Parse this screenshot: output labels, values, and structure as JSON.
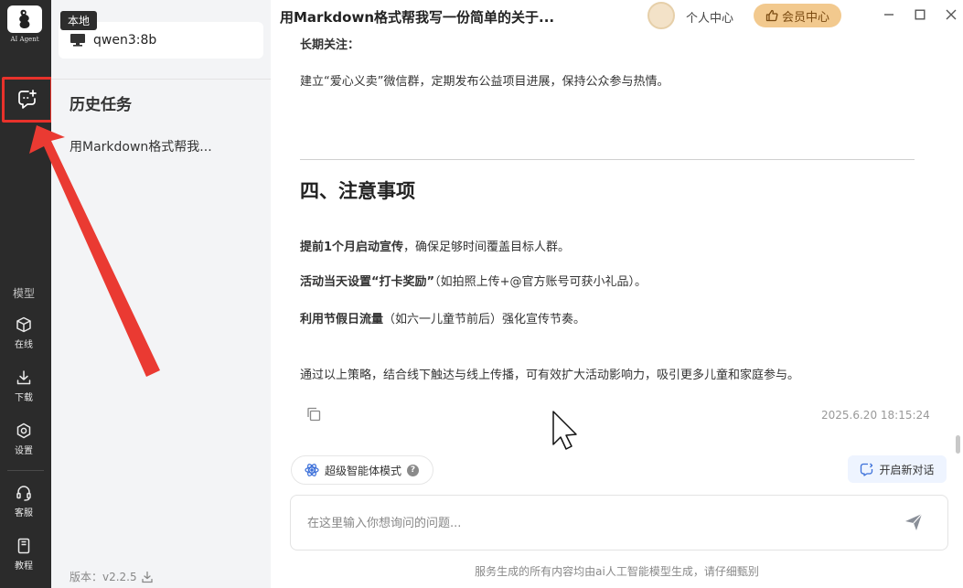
{
  "app": {
    "logo_caption": "AI Agent",
    "title": "用Markdown格式帮我写一份简单的关于..."
  },
  "rail": {
    "section_label": "模型",
    "items": [
      {
        "label": "在线",
        "icon": "cube-icon"
      },
      {
        "label": "下载",
        "icon": "download-icon"
      },
      {
        "label": "设置",
        "icon": "gear-icon"
      },
      {
        "label": "客服",
        "icon": "headset-icon"
      },
      {
        "label": "教程",
        "icon": "book-icon"
      }
    ]
  },
  "panel": {
    "tooltip": "本地",
    "model_name": "qwen3:8b",
    "history_title": "历史任务",
    "history_items": [
      "用Markdown格式帮我..."
    ],
    "version": "版本：v2.2.5"
  },
  "header": {
    "user_center": "个人中心",
    "vip_label": "会员中心"
  },
  "content": {
    "long_term_label": "长期关注：",
    "long_term_text": "建立“爱心义卖”微信群，定期发布公益项目进展，保持公众参与热情。",
    "section_heading": "四、注意事项",
    "notes": [
      {
        "bold": "提前1个月启动宣传",
        "rest": "，确保足够时间覆盖目标人群。"
      },
      {
        "bold": "活动当天设置“打卡奖励”",
        "rest": "（如拍照上传+@官方账号可获小礼品）。"
      },
      {
        "bold": "利用节假日流量",
        "rest": "（如六一儿童节前后）强化宣传节奏。"
      }
    ],
    "summary": "通过以上策略，结合线下触达与线上传播，可有效扩大活动影响力，吸引更多儿童和家庭参与。",
    "timestamp": "2025.6.20 18:15:24"
  },
  "bottom": {
    "agent_mode_label": "超级智能体模式",
    "new_conversation_label": "开启新对话",
    "input_placeholder": "在这里输入你想询问的问题...",
    "disclaimer": "服务生成的所有内容均由ai人工智能模型生成，请仔细甄别"
  },
  "colors": {
    "highlight": "#e8322b",
    "rail_bg": "#2b2b2b",
    "vip_bg": "#f2c98e"
  }
}
